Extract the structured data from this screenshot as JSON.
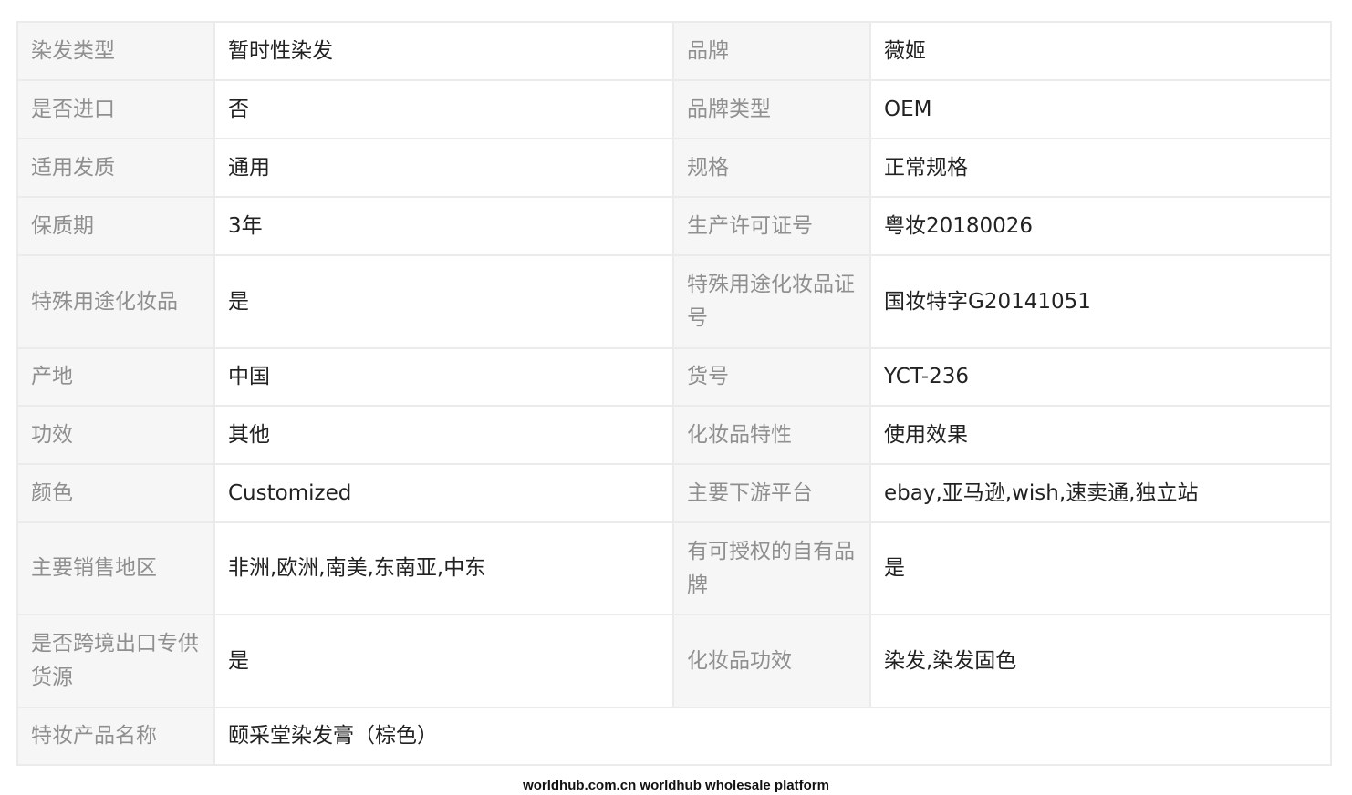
{
  "rows": [
    {
      "l1": "染发类型",
      "v1": "暂时性染发",
      "l2": "品牌",
      "v2": "薇姬"
    },
    {
      "l1": "是否进口",
      "v1": "否",
      "l2": "品牌类型",
      "v2": "OEM"
    },
    {
      "l1": "适用发质",
      "v1": "通用",
      "l2": "规格",
      "v2": "正常规格"
    },
    {
      "l1": "保质期",
      "v1": "3年",
      "l2": "生产许可证号",
      "v2": "粤妆20180026"
    },
    {
      "l1": "特殊用途化妆品",
      "v1": "是",
      "l2": "特殊用途化妆品证号",
      "v2": "国妆特字G20141051"
    },
    {
      "l1": "产地",
      "v1": "中国",
      "l2": "货号",
      "v2": "YCT-236"
    },
    {
      "l1": "功效",
      "v1": "其他",
      "l2": "化妆品特性",
      "v2": "使用效果"
    },
    {
      "l1": "颜色",
      "v1": "Customized",
      "l2": "主要下游平台",
      "v2": "ebay,亚马逊,wish,速卖通,独立站"
    },
    {
      "l1": "主要销售地区",
      "v1": "非洲,欧洲,南美,东南亚,中东",
      "l2": "有可授权的自有品牌",
      "v2": "是"
    },
    {
      "l1": "是否跨境出口专供货源",
      "v1": "是",
      "l2": "化妆品功效",
      "v2": "染发,染发固色"
    },
    {
      "l1": "特妆产品名称",
      "v1": "颐采堂染发膏（棕色）"
    }
  ],
  "footer": "worldhub.com.cn worldhub wholesale platform"
}
